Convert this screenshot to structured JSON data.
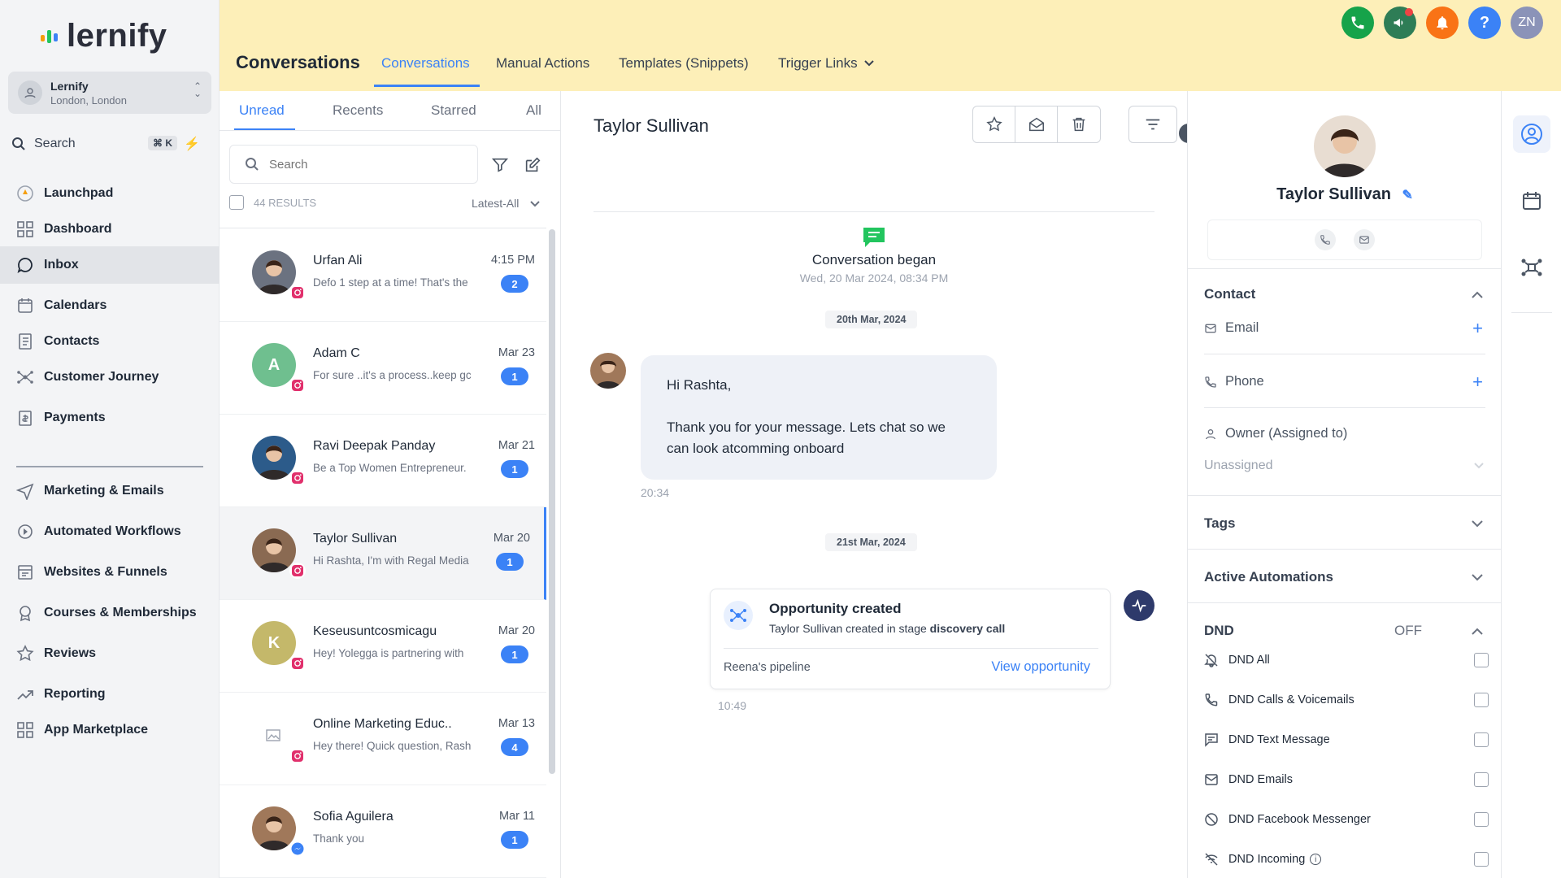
{
  "app": {
    "logo_text": "lernify"
  },
  "location": {
    "name": "Lernify",
    "city": "London, London"
  },
  "sidebar_search": {
    "label": "Search",
    "shortcut": "⌘ K"
  },
  "nav": [
    {
      "label": "Launchpad",
      "icon": "launchpad-icon"
    },
    {
      "label": "Dashboard",
      "icon": "dashboard-grid-icon"
    },
    {
      "label": "Inbox",
      "icon": "chat-bubble-icon",
      "active": true
    },
    {
      "label": "Calendars",
      "icon": "calendar-icon"
    },
    {
      "label": "Contacts",
      "icon": "contacts-book-icon"
    },
    {
      "label": "Customer Journey",
      "icon": "journey-icon"
    },
    {
      "label": "Payments",
      "icon": "payments-icon"
    },
    {
      "label": "Marketing & Emails",
      "icon": "send-icon"
    },
    {
      "label": "Automated Workflows",
      "icon": "workflow-icon"
    },
    {
      "label": "Websites & Funnels",
      "icon": "website-icon"
    },
    {
      "label": "Courses & Memberships",
      "icon": "courses-icon"
    },
    {
      "label": "Reviews",
      "icon": "star-icon"
    },
    {
      "label": "Reporting",
      "icon": "trend-icon"
    },
    {
      "label": "App Marketplace",
      "icon": "apps-grid-icon"
    }
  ],
  "header": {
    "title": "Conversations",
    "tabs": [
      "Conversations",
      "Manual Actions",
      "Templates (Snippets)",
      "Trigger Links"
    ],
    "user_initials": "ZN",
    "colors": {
      "phone": "#16a34a",
      "megaphone": "#2e7d56",
      "bell": "#f97316",
      "help": "#3b82f6",
      "user": "#8b93b8"
    }
  },
  "list": {
    "tabs": [
      "Unread",
      "Recents",
      "Starred",
      "All"
    ],
    "search_placeholder": "Search",
    "results": "44 RESULTS",
    "sort": "Latest-All",
    "conversations": [
      {
        "name": "Urfan Ali",
        "preview": "Defo 1 step at a time! That's the",
        "time": "4:15 PM",
        "unread": "2",
        "source": "instagram",
        "avatar_color": "#6b7280"
      },
      {
        "name": "Adam C",
        "preview": "For sure ..it's a process..keep gc",
        "time": "Mar 23",
        "unread": "1",
        "source": "instagram",
        "initial": "A",
        "avatar_color": "#6fbf8f"
      },
      {
        "name": "Ravi Deepak Panday",
        "preview": "Be a Top Women Entrepreneur.",
        "time": "Mar 21",
        "unread": "1",
        "source": "instagram",
        "avatar_color": "#2c5b8a"
      },
      {
        "name": "Taylor Sullivan",
        "preview": "Hi Rashta, I'm with Regal Media",
        "time": "Mar 20",
        "unread": "1",
        "source": "instagram",
        "avatar_color": "#8a6a52",
        "selected": true
      },
      {
        "name": "Keseusuntcosmicagu",
        "preview": "Hey! Yolegga is partnering with",
        "time": "Mar 20",
        "unread": "1",
        "source": "instagram",
        "initial": "K",
        "avatar_color": "#c4b86a"
      },
      {
        "name": "Online Marketing Educ..",
        "preview": "Hey there! Quick question, Rash",
        "time": "Mar 13",
        "unread": "4",
        "source": "instagram",
        "avatar_color": "#ffffff"
      },
      {
        "name": "Sofia Aguilera",
        "preview": "Thank you",
        "time": "Mar 11",
        "unread": "1",
        "source": "messenger",
        "avatar_color": "#a0785a"
      }
    ]
  },
  "chat": {
    "contact_name": "Taylor Sullivan",
    "began_title": "Conversation began",
    "began_date": "Wed, 20 Mar 2024, 08:34 PM",
    "date1": "20th Mar, 2024",
    "message_line1": "Hi Rashta,",
    "message_line2": "Thank you for your message. Lets chat so we can look atcomming onboard",
    "message_time": "20:34",
    "date2": "21st Mar, 2024",
    "opp_title": "Opportunity created",
    "opp_desc_prefix": "Taylor Sullivan created in stage ",
    "opp_stage": "discovery call",
    "opp_pipeline": "Reena's pipeline",
    "opp_link": "View opportunity",
    "opp_time": "10:49"
  },
  "contact": {
    "name": "Taylor Sullivan",
    "section_contact": "Contact",
    "email_label": "Email",
    "phone_label": "Phone",
    "owner_label": "Owner (Assigned to)",
    "owner_value": "Unassigned",
    "tags": "Tags",
    "automations": "Active Automations",
    "dnd": "DND",
    "dnd_state": "OFF",
    "dnd_items": [
      {
        "label": "DND All",
        "icon": "bell-off-icon"
      },
      {
        "label": "DND Calls & Voicemails",
        "icon": "phone-icon"
      },
      {
        "label": "DND Text Message",
        "icon": "message-icon"
      },
      {
        "label": "DND Emails",
        "icon": "mail-icon"
      },
      {
        "label": "DND Facebook Messenger",
        "icon": "block-icon"
      },
      {
        "label": "DND Incoming",
        "icon": "wifi-off-icon"
      }
    ]
  }
}
